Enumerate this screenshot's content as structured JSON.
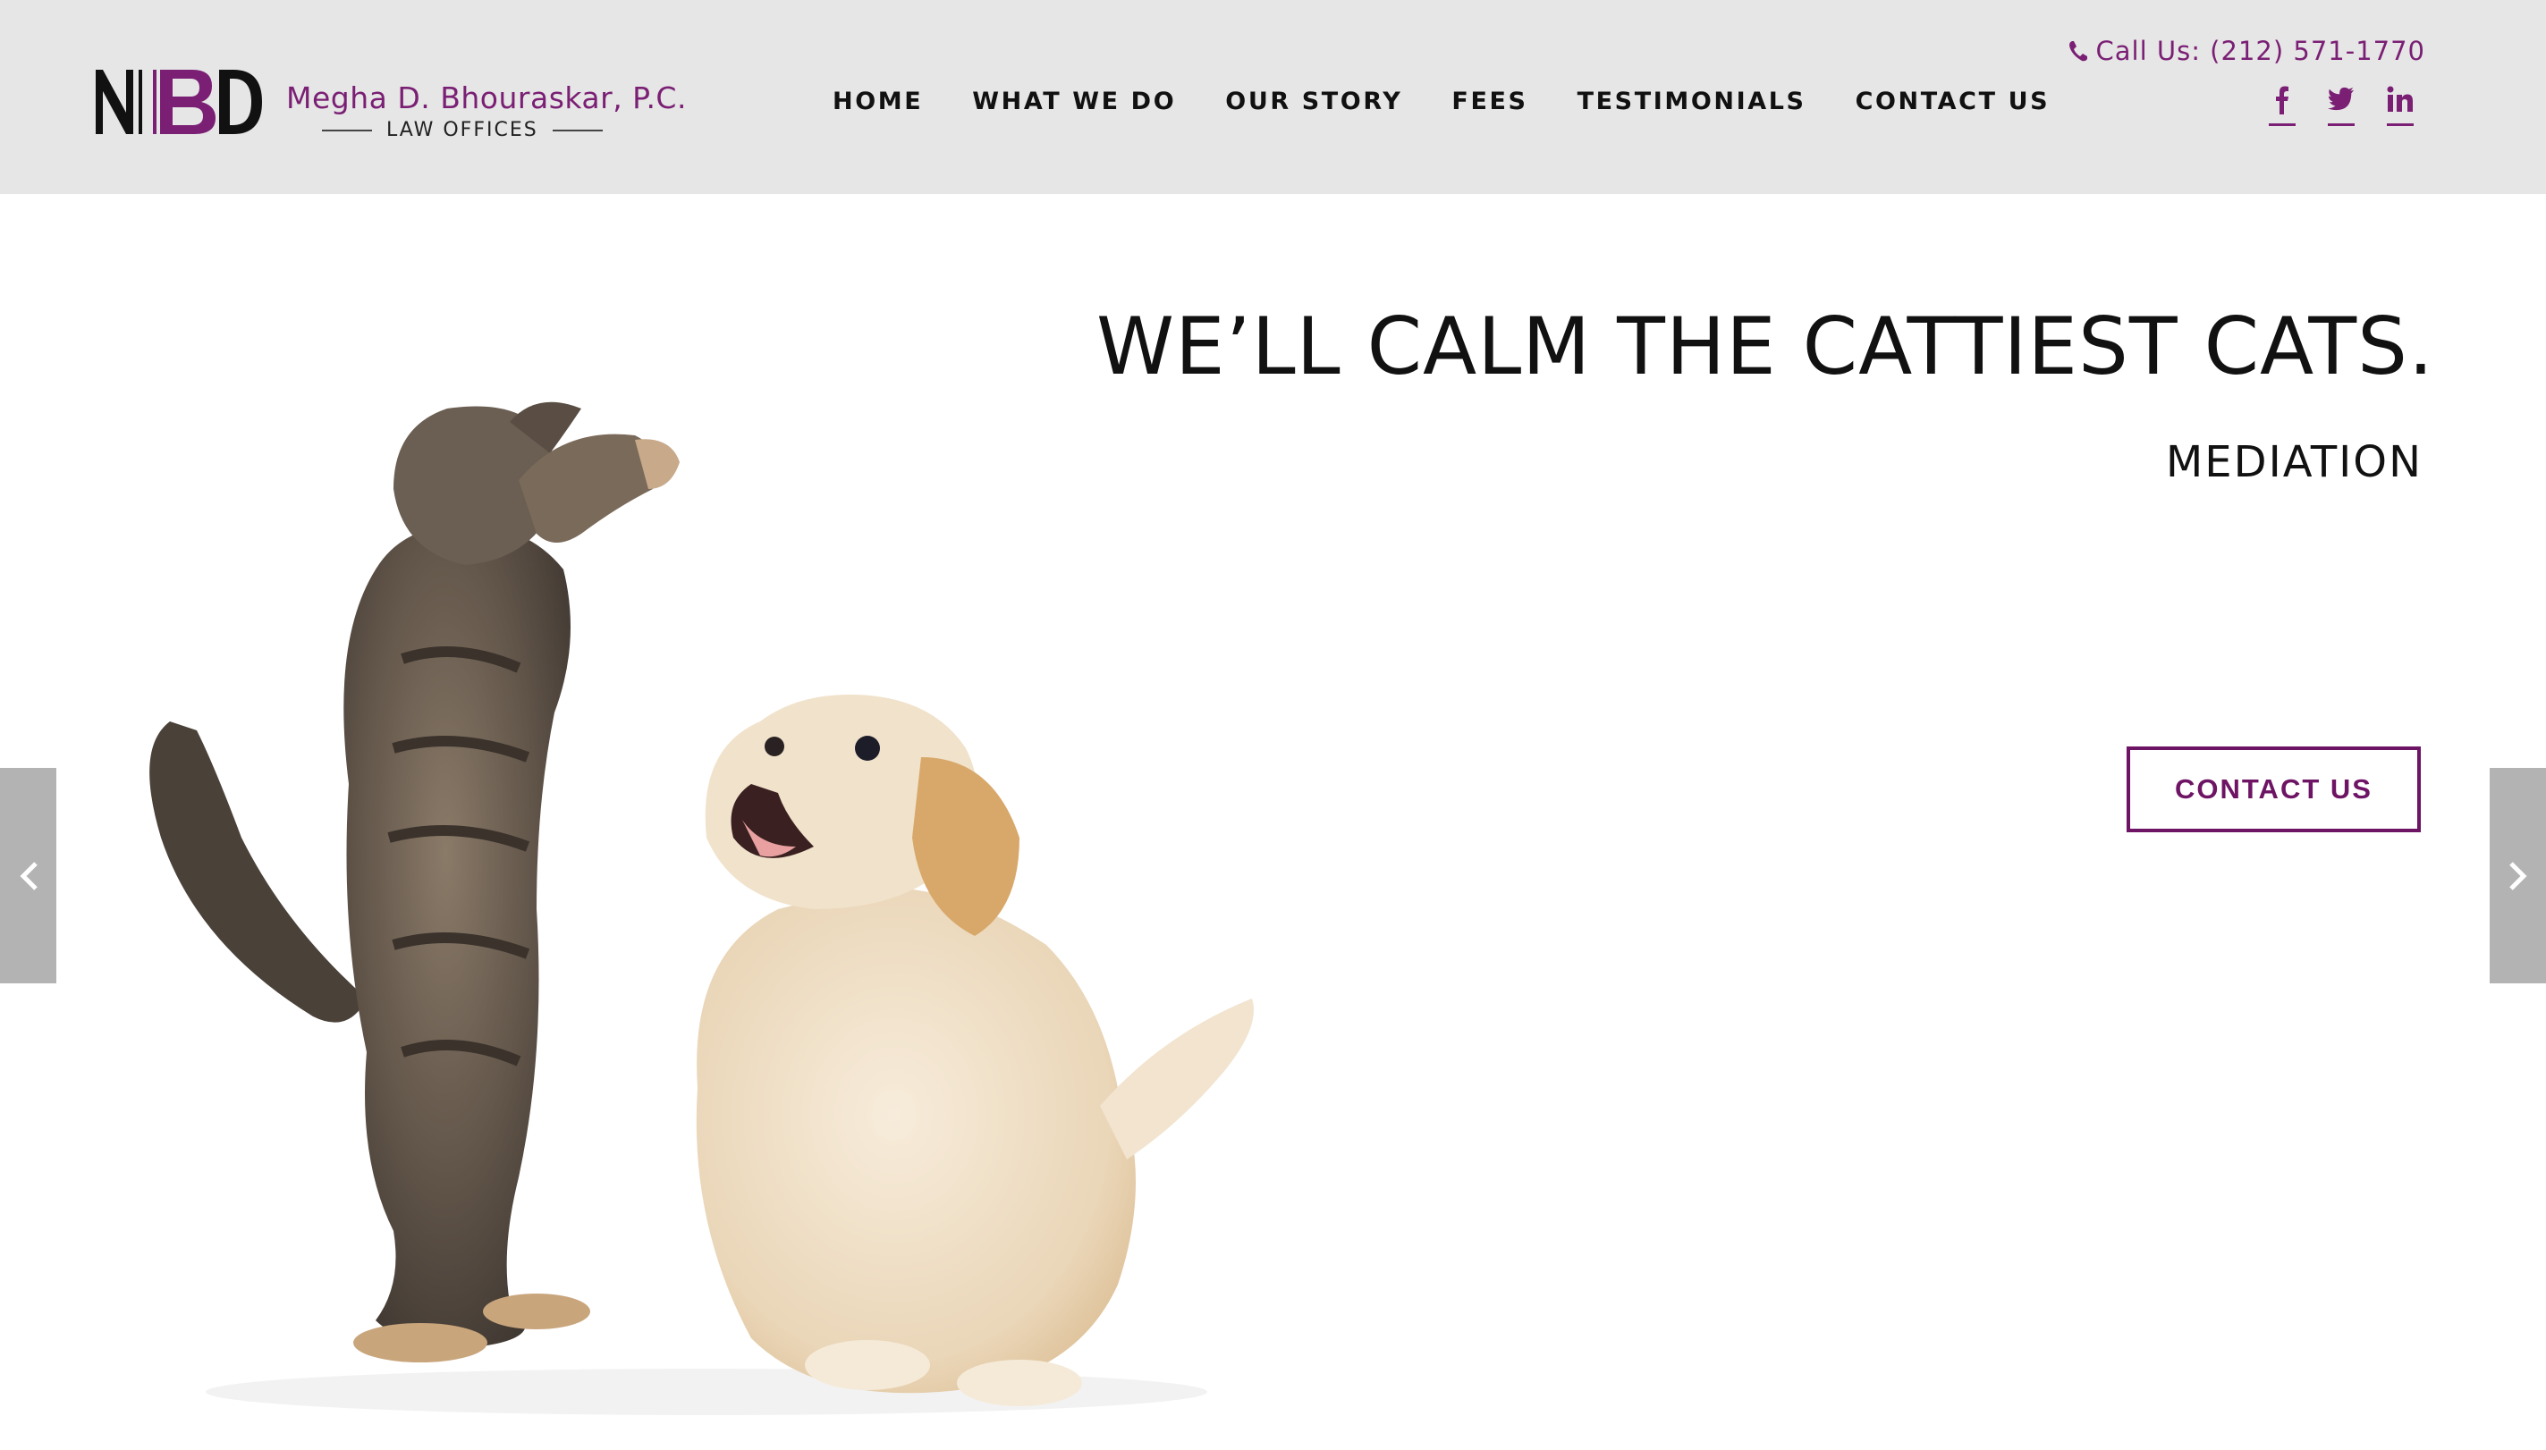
{
  "brand": {
    "logo_mark": "MBD",
    "name": "Megha D. Bhouraskar, P.C.",
    "subtitle": "LAW OFFICES",
    "accent_color": "#7a1f74"
  },
  "header": {
    "call_us": "Call Us: (212) 571-1770",
    "phone_icon": "phone-icon",
    "social": [
      {
        "name": "facebook-icon"
      },
      {
        "name": "twitter-icon"
      },
      {
        "name": "linkedin-icon"
      }
    ]
  },
  "nav": {
    "items": [
      {
        "label": "HOME"
      },
      {
        "label": "WHAT WE DO"
      },
      {
        "label": "OUR STORY"
      },
      {
        "label": "FEES"
      },
      {
        "label": "TESTIMONIALS"
      },
      {
        "label": "CONTACT US"
      }
    ]
  },
  "hero": {
    "headline": "WE’LL CALM THE CATTIEST CATS.",
    "subheadline": "MEDIATION",
    "cta_label": "CONTACT US",
    "prev_icon": "chevron-left-icon",
    "next_icon": "chevron-right-icon"
  }
}
